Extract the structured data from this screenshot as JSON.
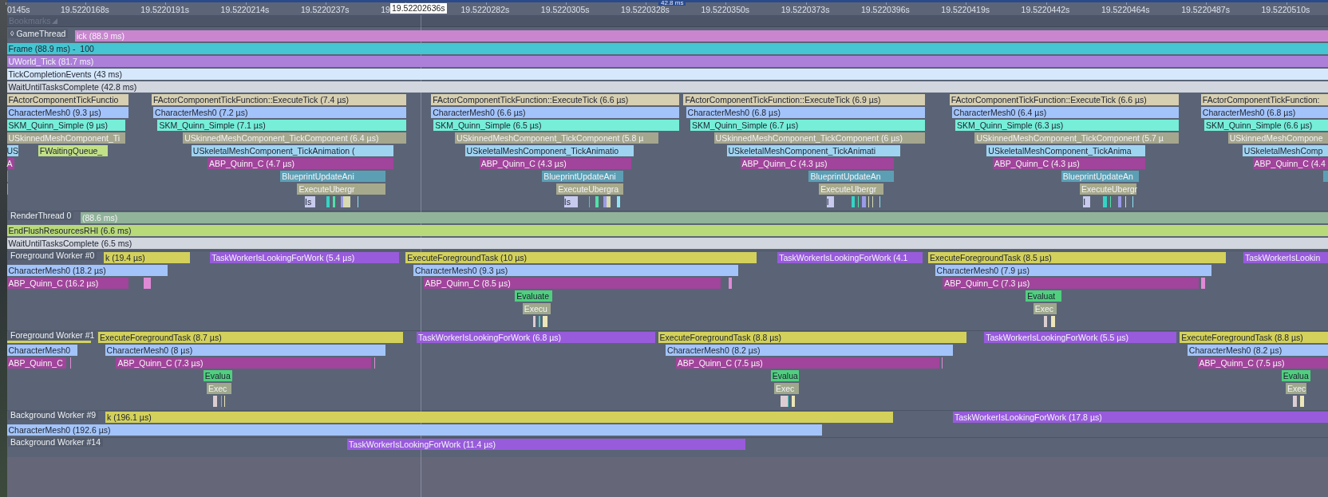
{
  "timeline": {
    "range_label": "42.8 ms",
    "cursor_time": "19.52202636s",
    "ticks": [
      "0145s",
      "19.5220168s",
      "19.5220191s",
      "19.5220214s",
      "19.5220237s",
      "19.",
      "19.5220282s",
      "19.5220305s",
      "19.5220328s",
      "19.5220350s",
      "19.5220373s",
      "19.5220396s",
      "19.5220419s",
      "19.5220442s",
      "19.5220464s",
      "19.5220487s",
      "19.5220510s"
    ]
  },
  "bookmarks": {
    "label": "Bookmarks"
  },
  "tracks": [
    {
      "name": "GameThread",
      "icon": "◊",
      "lanes": [
        [
          {
            "label": "ick (88.9 ms)",
            "color": "#c986cf"
          }
        ],
        [
          {
            "label": "Frame (88.9 ms) -  100",
            "color": "#45c6d2"
          }
        ],
        [
          {
            "label": "UWorld_Tick (81.7 ms)",
            "color": "#ac80d9"
          }
        ],
        [
          {
            "label": "TickCompletionEvents (43 ms)",
            "color": "#d6e8fb"
          }
        ],
        [
          {
            "label": "WaitUntilTasksComplete (42.8 ms)",
            "color": "#d2d6de"
          }
        ],
        [
          {
            "label": "FActorComponentTickFunctio",
            "color": "#d7cfb1"
          },
          {
            "label": "FActorComponentTickFunction::ExecuteTick (7.4 µs)",
            "color": "#d7cfb1"
          },
          {
            "label": "FActorComponentTickFunction::ExecuteTick (6.6 µs)",
            "color": "#d7cfb1"
          },
          {
            "label": "FActorComponentTickFunction::ExecuteTick (6.9 µs)",
            "color": "#d7cfb1"
          },
          {
            "label": "FActorComponentTickFunction::ExecuteTick (6.6 µs)",
            "color": "#d7cfb1"
          },
          {
            "label": "FActorComponentTickFunction:",
            "color": "#d7cfb1"
          }
        ],
        [
          {
            "label": "CharacterMesh0 (9.3 µs)",
            "color": "#a3c4fa"
          },
          {
            "label": "CharacterMesh0 (7.2 µs)",
            "color": "#a3c4fa"
          },
          {
            "label": "CharacterMesh0 (6.6 µs)",
            "color": "#a3c4fa"
          },
          {
            "label": "CharacterMesh0 (6.8 µs)",
            "color": "#a3c4fa"
          },
          {
            "label": "CharacterMesh0 (6.4 µs)",
            "color": "#a3c4fa"
          },
          {
            "label": "CharacterMesh0 (6.8 µs)",
            "color": "#a3c4fa"
          }
        ],
        [
          {
            "label": "SKM_Quinn_Simple (9 µs)",
            "color": "#76eed8"
          },
          {
            "label": "SKM_Quinn_Simple (7.1 µs)",
            "color": "#76eed8"
          },
          {
            "label": "SKM_Quinn_Simple (6.5 µs)",
            "color": "#76eed8"
          },
          {
            "label": "SKM_Quinn_Simple (6.7 µs)",
            "color": "#76eed8"
          },
          {
            "label": "SKM_Quinn_Simple (6.3 µs)",
            "color": "#76eed8"
          },
          {
            "label": "SKM_Quinn_Simple (6.6 µs)",
            "color": "#76eed8"
          }
        ],
        [
          {
            "label": "USkinnedMeshComponent_Ti",
            "color": "#a5a68e"
          },
          {
            "label": "USkinnedMeshComponent_TickComponent (6.4 µs)",
            "color": "#a5a68e"
          },
          {
            "label": "USkinnedMeshComponent_TickComponent (5.8 µ",
            "color": "#a5a68e"
          },
          {
            "label": "USkinnedMeshComponent_TickComponent (6 µs)",
            "color": "#a5a68e"
          },
          {
            "label": "USkinnedMeshComponent_TickComponent (5.7 µ",
            "color": "#a5a68e"
          },
          {
            "label": "USkinnedMeshCompone",
            "color": "#a5a68e"
          }
        ],
        [
          {
            "label": "US",
            "color": "#9fd4f1"
          },
          {
            "label": "FWaitingQueue_",
            "color": "#c2e187"
          },
          {
            "label": "USkeletalMeshComponent_TickAnimation (",
            "color": "#9fd4f1"
          },
          {
            "label": "USkeletalMeshComponent_TickAnimatio",
            "color": "#9fd4f1"
          },
          {
            "label": "USkeletalMeshComponent_TickAnimati",
            "color": "#9fd4f1"
          },
          {
            "label": "USkeletalMeshComponent_TickAnima",
            "color": "#9fd4f1"
          },
          {
            "label": "USkeletalMeshComp",
            "color": "#9fd4f1"
          }
        ],
        [
          {
            "label": "A",
            "color": "#a1449b"
          },
          {
            "label": "ABP_Quinn_C (4.7 µs)",
            "color": "#a1449b"
          },
          {
            "label": "ABP_Quinn_C (4.3 µs)",
            "color": "#a1449b"
          },
          {
            "label": "ABP_Quinn_C (4.3 µs)",
            "color": "#a1449b"
          },
          {
            "label": "ABP_Quinn_C (4.3 µs)",
            "color": "#a1449b"
          },
          {
            "label": "ABP_Quinn_C (4.4",
            "color": "#a1449b"
          }
        ],
        [
          {
            "color": "#5c9fb5"
          },
          {
            "label": "BlueprintUpdateAni",
            "color": "#5c9fb5"
          },
          {
            "label": "BlueprintUpdateAni",
            "color": "#5c9fb5"
          },
          {
            "label": "BlueprintUpdateAn",
            "color": "#5c9fb5"
          },
          {
            "label": "BlueprintUpdateAn",
            "color": "#5c9fb5"
          },
          {
            "color": "#5c9fb5"
          }
        ],
        [
          {
            "color": "#a7a98c"
          },
          {
            "label": "ExecuteUbergr",
            "color": "#a7a98c"
          },
          {
            "label": "ExecuteUbergra",
            "color": "#a7a98c"
          },
          {
            "label": "ExecuteUbergr",
            "color": "#a7a98c"
          },
          {
            "label": "ExecuteUbergr",
            "color": "#a7a98c"
          }
        ],
        [
          {
            "label": "Is",
            "color": "#c8cbee"
          },
          {
            "color": "#34d4c4"
          },
          {
            "color": "#52e0a8"
          },
          {
            "color": "#9b9be6"
          },
          {
            "color": "#d8dab0"
          },
          {
            "color": "#8fe6f2"
          },
          {
            "label": "Is",
            "color": "#c8cbee"
          },
          {
            "color": "#34d4c4"
          },
          {
            "color": "#52e0a8"
          },
          {
            "color": "#9b9be6"
          },
          {
            "color": "#d8dab0"
          },
          {
            "color": "#8fe6f2"
          },
          {
            "label": "I",
            "color": "#c8cbee"
          },
          {
            "color": "#34d4c4"
          },
          {
            "color": "#52e0a8"
          },
          {
            "color": "#9b9be6"
          },
          {
            "color": "#d8dab0"
          },
          {
            "color": "#d8dab0"
          },
          {
            "color": "#8fe6f2"
          },
          {
            "label": "I",
            "color": "#c8cbee"
          },
          {
            "color": "#34d4c4"
          },
          {
            "color": "#52e0a8"
          },
          {
            "color": "#9b9be6"
          },
          {
            "color": "#d8dab0"
          },
          {
            "color": "#8fe6f2"
          }
        ]
      ]
    },
    {
      "name": "RenderThread 0",
      "lanes": [
        [
          {
            "label": "(88.6 ms)",
            "color": "#91b39a"
          }
        ],
        [
          {
            "label": "EndFlushResourcesRHI (6.6 ms)",
            "color": "#b9da79"
          }
        ],
        [
          {
            "label": "WaitUntilTasksComplete (6.5 ms)",
            "color": "#d2d6de"
          }
        ]
      ]
    },
    {
      "name": "Foreground Worker #0",
      "lanes": [
        [
          {
            "label": "k (19.4 µs)",
            "color": "#d3d15c"
          },
          {
            "label": "TaskWorkerIsLookingForWork (5.4 µs)",
            "color": "#985bdc"
          },
          {
            "label": "ExecuteForegroundTask (10 µs)",
            "color": "#d3d15c"
          },
          {
            "label": "TaskWorkerIsLookingForWork (4.1",
            "color": "#985bdc"
          },
          {
            "label": "ExecuteForegroundTask (8.5 µs)",
            "color": "#d3d15c"
          },
          {
            "label": "TaskWorkerIsLookin",
            "color": "#985bdc"
          }
        ],
        [
          {
            "label": "CharacterMesh0 (18.2 µs)",
            "color": "#a3c4fa"
          },
          {
            "label": "CharacterMesh0 (9.3 µs)",
            "color": "#a3c4fa"
          },
          {
            "label": "CharacterMesh0 (7.9 µs)",
            "color": "#a3c4fa"
          }
        ],
        [
          {
            "label": "ABP_Quinn_C (16.2 µs)",
            "color": "#a1449b"
          },
          {
            "color": "#e08ad6"
          },
          {
            "label": "ABP_Quinn_C (8.5 µs)",
            "color": "#a1449b"
          },
          {
            "color": "#e08ad6"
          },
          {
            "label": "ABP_Quinn_C (7.3 µs)",
            "color": "#a1449b"
          },
          {
            "color": "#e08ad6"
          }
        ],
        [
          {
            "label": "Evaluate",
            "color": "#50cf7f"
          },
          {
            "label": "Evaluat",
            "color": "#50cf7f"
          }
        ],
        [
          {
            "label": "Execu",
            "color": "#9fa88d"
          },
          {
            "label": "Exec",
            "color": "#9fa88d"
          }
        ],
        [
          {
            "color": "#dccdd2"
          },
          {
            "color": "#40d6c6"
          },
          {
            "color": "#ece6b8"
          },
          {
            "color": "#dccdd2"
          },
          {
            "color": "#ece6b8"
          }
        ]
      ]
    },
    {
      "name": "Foreground Worker #1",
      "lanes": [
        [
          {
            "color": "#d3d15c"
          },
          {
            "label": "ExecuteForegroundTask (8.7 µs)",
            "color": "#d3d15c"
          },
          {
            "label": "TaskWorkerIsLookingForWork (6.8 µs)",
            "color": "#985bdc"
          },
          {
            "label": "ExecuteForegroundTask (8.8 µs)",
            "color": "#d3d15c"
          },
          {
            "label": "TaskWorkerIsLookingForWork (5.5 µs)",
            "color": "#985bdc"
          },
          {
            "label": "ExecuteForegroundTask (8.8 µs)",
            "color": "#d3d15c"
          }
        ],
        [
          {
            "label": "CharacterMesh0",
            "color": "#a3c4fa"
          },
          {
            "label": "CharacterMesh0 (8 µs)",
            "color": "#a3c4fa"
          },
          {
            "label": "CharacterMesh0 (8.2 µs)",
            "color": "#a3c4fa"
          },
          {
            "label": "CharacterMesh0 (8.2 µs)",
            "color": "#a3c4fa"
          }
        ],
        [
          {
            "label": "ABP_Quinn_C",
            "color": "#a1449b"
          },
          {
            "color": "#e08ad6"
          },
          {
            "label": "ABP_Quinn_C (7.3 µs)",
            "color": "#a1449b"
          },
          {
            "color": "#e08ad6"
          },
          {
            "label": "ABP_Quinn_C (7.5 µs)",
            "color": "#a1449b"
          },
          {
            "color": "#e08ad6"
          },
          {
            "label": "ABP_Quinn_C (7.5 µs)",
            "color": "#a1449b"
          }
        ],
        [
          {
            "label": "Evalua",
            "color": "#50cf7f"
          },
          {
            "label": "Evalua",
            "color": "#50cf7f"
          },
          {
            "label": "Evalua",
            "color": "#50cf7f"
          }
        ],
        [
          {
            "label": "Exec",
            "color": "#9fa88d"
          },
          {
            "label": "Exec",
            "color": "#9fa88d"
          },
          {
            "label": "Exec",
            "color": "#9fa88d"
          }
        ],
        [
          {
            "color": "#dccdd2"
          },
          {
            "color": "#40d6c6"
          },
          {
            "color": "#ece6b8"
          },
          {
            "color": "#dccdd2"
          },
          {
            "color": "#40d6c6"
          },
          {
            "color": "#ece6b8"
          },
          {
            "color": "#dccdd2"
          },
          {
            "color": "#ece6b8"
          }
        ]
      ]
    },
    {
      "name": "Background Worker #9",
      "lanes": [
        [
          {
            "label": "k (196.1 µs)",
            "color": "#d3d15c"
          },
          {
            "label": "TaskWorkerIsLookingForWork (17.8 µs)",
            "color": "#985bdc"
          }
        ],
        [
          {
            "label": "CharacterMesh0 (192.6 µs)",
            "color": "#a3c4fa"
          }
        ]
      ]
    },
    {
      "name": "Background Worker #14",
      "lanes": [
        [
          {
            "label": "TaskWorkerIsLookingForWork (11.4 µs)",
            "color": "#985bdc"
          }
        ]
      ]
    }
  ]
}
